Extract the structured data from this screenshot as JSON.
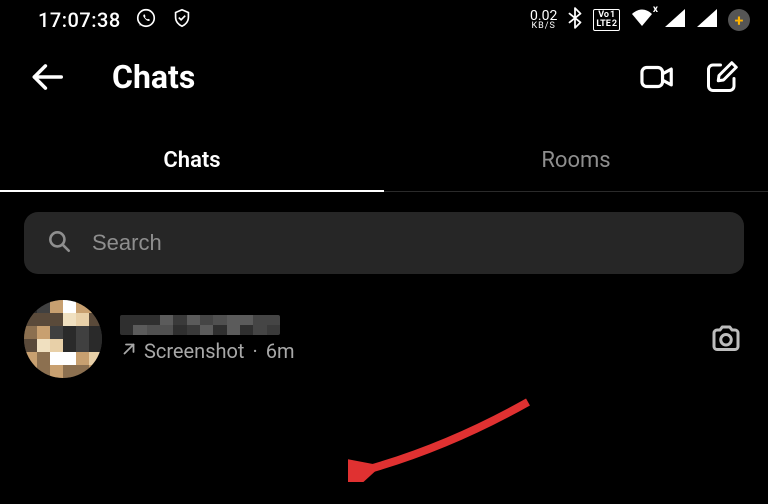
{
  "status": {
    "clock": "17:07:38",
    "data_rate_value": "0.02",
    "data_rate_unit": "KB/S",
    "lte_top": "Vo 1",
    "lte_bot": "LTE 2",
    "wifi_badge": "x",
    "plus_label": "+"
  },
  "header": {
    "title": "Chats"
  },
  "tabs": {
    "chats": "Chats",
    "rooms": "Rooms"
  },
  "search": {
    "placeholder": "Search"
  },
  "chat": {
    "subtext_label": "Screenshot",
    "subtext_sep": "·",
    "subtext_time": "6m"
  }
}
